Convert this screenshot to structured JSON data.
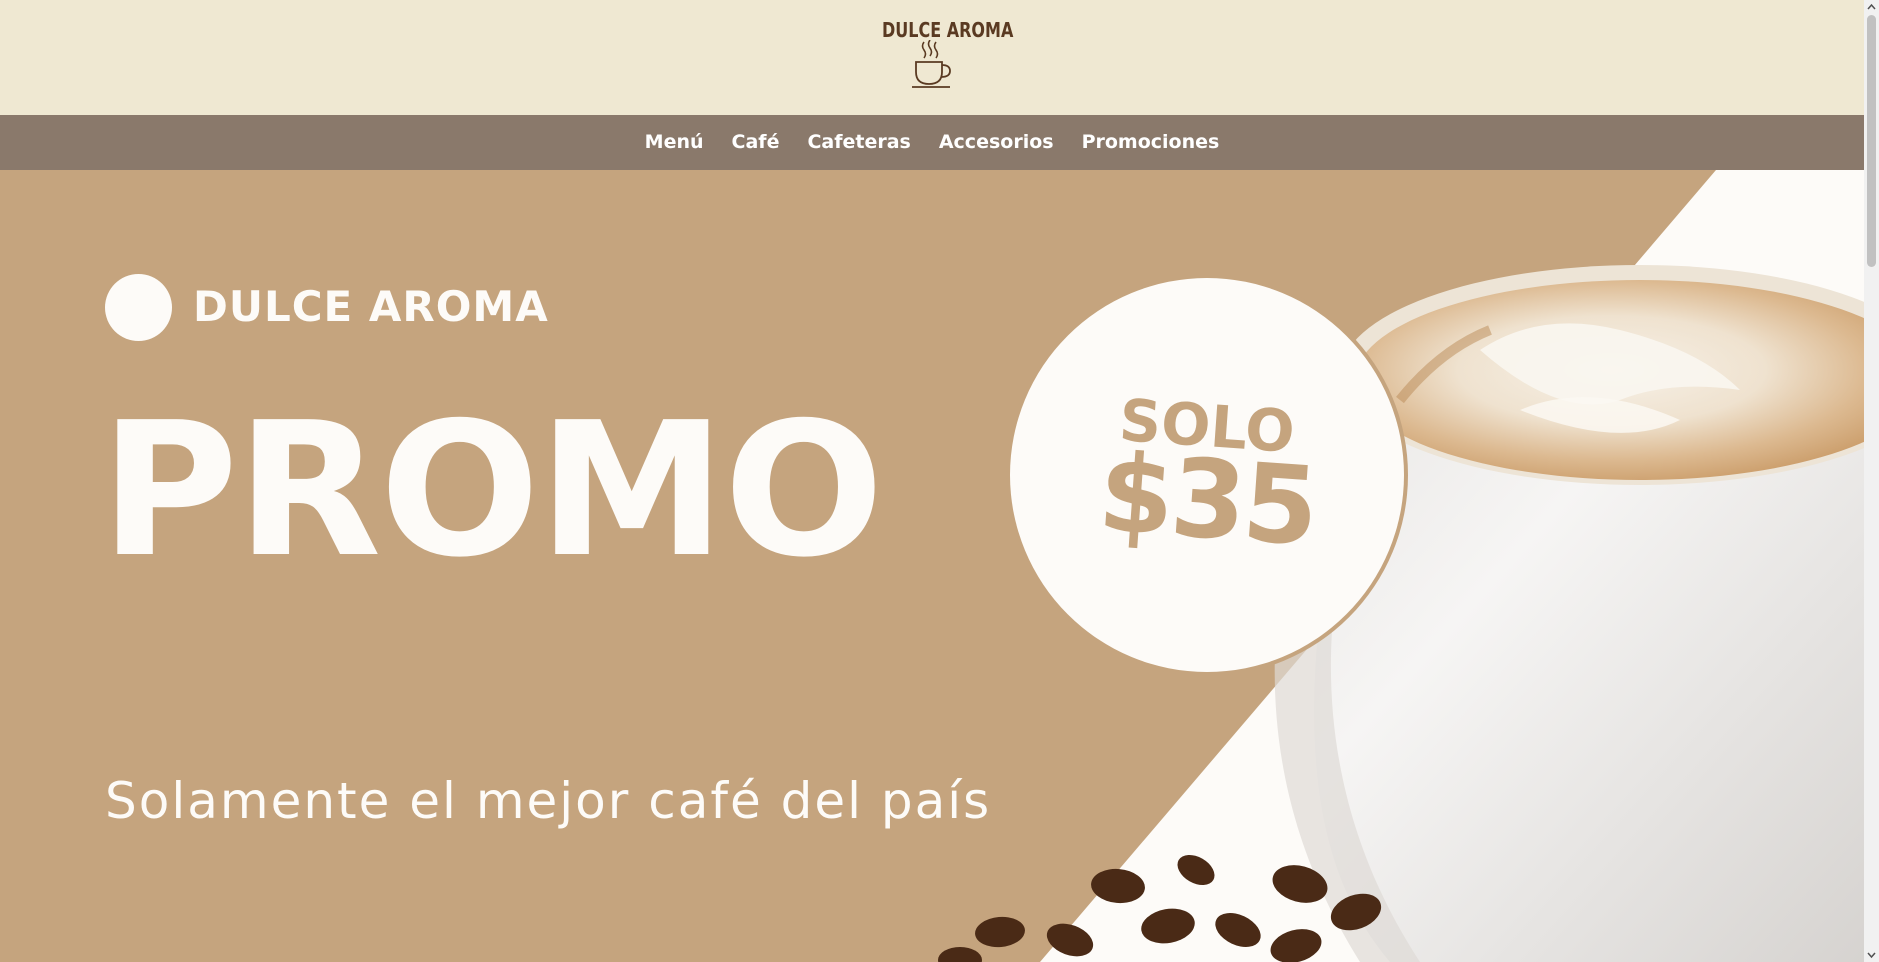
{
  "header": {
    "logo_text": "DULCE AROMA",
    "logo_icon": "coffee-cup-icon"
  },
  "nav": {
    "items": [
      "Menú",
      "Café",
      "Cafeteras",
      "Accesorios",
      "Promociones"
    ]
  },
  "hero": {
    "brand_name": "DULCE AROMA",
    "title": "PROMO",
    "price_label": "SOLO",
    "price_amount": "$35",
    "tagline": "Solamente el mejor café del país",
    "photo": "cappuccino-with-coffee-beans"
  },
  "colors": {
    "header_bg": "#efe8d2",
    "nav_bg": "#8a796b",
    "hero_bg": "#c5a47e",
    "hero_text": "#fdfbf8",
    "logo_brown": "#5a3a22"
  }
}
